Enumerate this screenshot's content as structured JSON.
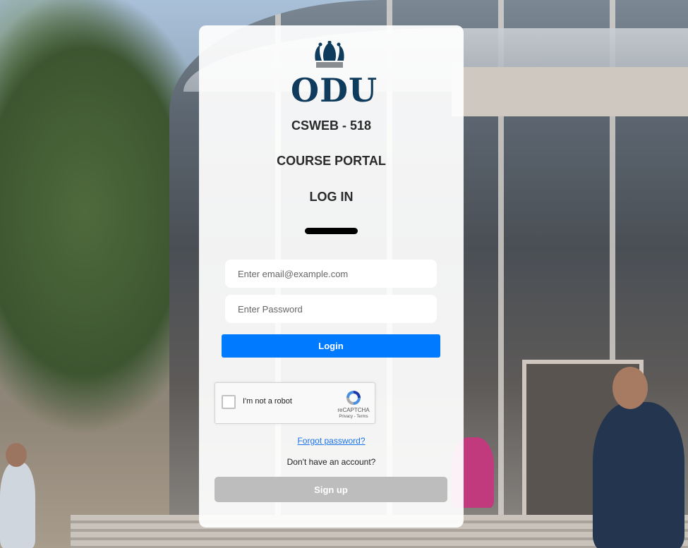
{
  "logo": {
    "wordmark": "ODU",
    "brand_color": "#0f3b5c"
  },
  "headings": {
    "course_code": "CSWEB - 518",
    "portal": "COURSE PORTAL",
    "action": "LOG IN"
  },
  "form": {
    "email_placeholder": "Enter email@example.com",
    "email_value": "",
    "password_placeholder": "Enter Password",
    "password_value": "",
    "login_label": "Login",
    "login_color": "#007bff"
  },
  "recaptcha": {
    "label": "I'm not a robot",
    "brand": "reCAPTCHA",
    "terms": "Privacy - Terms"
  },
  "links": {
    "forgot_password": "Forgot password?",
    "no_account": "Don't have an account?",
    "signup_label": "Sign up"
  }
}
